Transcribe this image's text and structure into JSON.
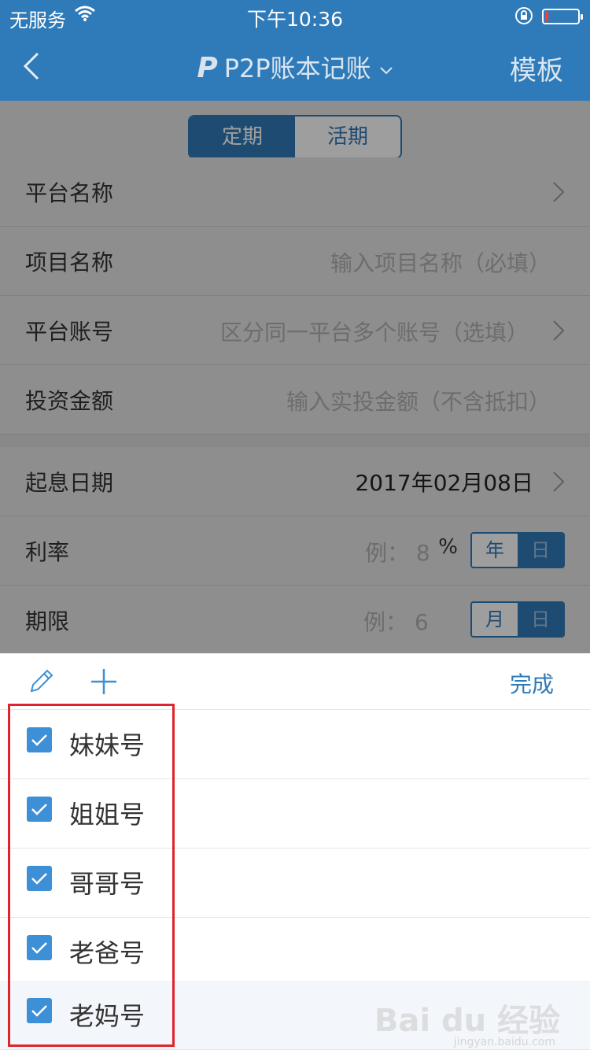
{
  "status_bar": {
    "carrier": "无服务",
    "time": "下午10:36"
  },
  "nav": {
    "logo_letter": "P",
    "title": "P2P账本记账",
    "right_action": "模板"
  },
  "segment": {
    "options": [
      "定期",
      "活期"
    ],
    "selected": "定期"
  },
  "form": {
    "platform_name": {
      "label": "平台名称"
    },
    "project_name": {
      "label": "项目名称",
      "placeholder": "输入项目名称（必填）"
    },
    "platform_account": {
      "label": "平台账号",
      "placeholder": "区分同一平台多个账号（选填）"
    },
    "investment_amount": {
      "label": "投资金额",
      "placeholder": "输入实投金额（不含抵扣）"
    },
    "start_date": {
      "label": "起息日期",
      "value": "2017年02月08日"
    },
    "rate": {
      "label": "利率",
      "example_prefix": "例：",
      "example_value": "8",
      "unit": "%",
      "toggle": [
        "年",
        "日"
      ],
      "toggle_selected": "年"
    },
    "term": {
      "label": "期限",
      "example_prefix": "例：",
      "example_value": "6",
      "toggle": [
        "月",
        "日"
      ],
      "toggle_selected": "月"
    }
  },
  "sheet": {
    "done_label": "完成",
    "accounts": [
      {
        "name": "妹妹号",
        "checked": true
      },
      {
        "name": "姐姐号",
        "checked": true
      },
      {
        "name": "哥哥号",
        "checked": true
      },
      {
        "name": "老爸号",
        "checked": true
      },
      {
        "name": "老妈号",
        "checked": true
      }
    ]
  },
  "watermark": {
    "main": "Bai du 经验",
    "sub": "jingyan.baidu.com"
  },
  "colors": {
    "brand": "#2f7ab8",
    "checkbox": "#3d8fd6",
    "highlight_box": "#e0242b"
  }
}
